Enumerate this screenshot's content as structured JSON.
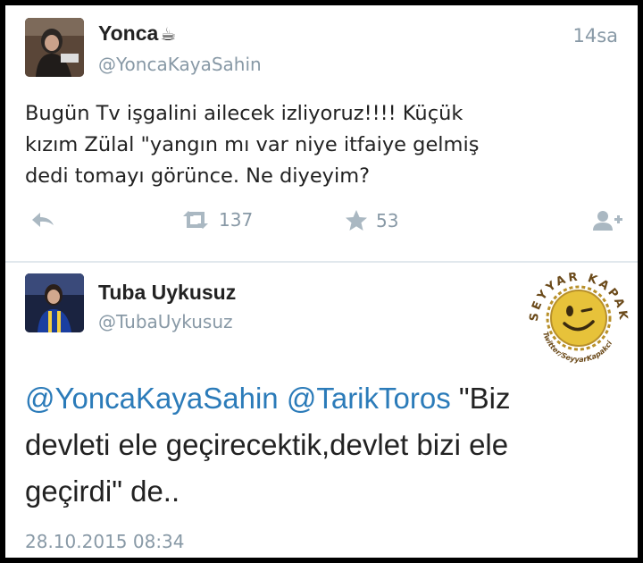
{
  "tweet1": {
    "display_name": "Yonca",
    "name_emoji": "☕",
    "handle": "@YoncaKayaSahin",
    "time": "14sa",
    "lines": [
      "Bugün Tv işgalini ailecek izliyoruz!!!! Küçük",
      "kızım Zülal \"yangın mı var niye itfaiye gelmiş",
      "dedi tomayı görünce. Ne diyeyim?"
    ],
    "retweets": "137",
    "likes": "53"
  },
  "tweet2": {
    "display_name": "Tuba Uykusuz",
    "handle": "@TubaUykusuz",
    "mention1": "@YoncaKayaSahin",
    "mention2": "@TarikToros",
    "text_after_mentions": "\"Biz",
    "line2": "devleti ele geçirecektik,devlet bizi ele",
    "line3": "geçirdi\" de..",
    "date": "28.10.2015 08:34"
  },
  "watermark": {
    "arc_text": "SEYYAR KAPAKÇI",
    "bottom_text": "Twitter/SeyyarKapakci"
  },
  "colors": {
    "link": "#2b7bb9",
    "muted": "#8899a6",
    "text": "#222222",
    "watermark": "#6b4a1a",
    "cap": "#e7c23a"
  }
}
